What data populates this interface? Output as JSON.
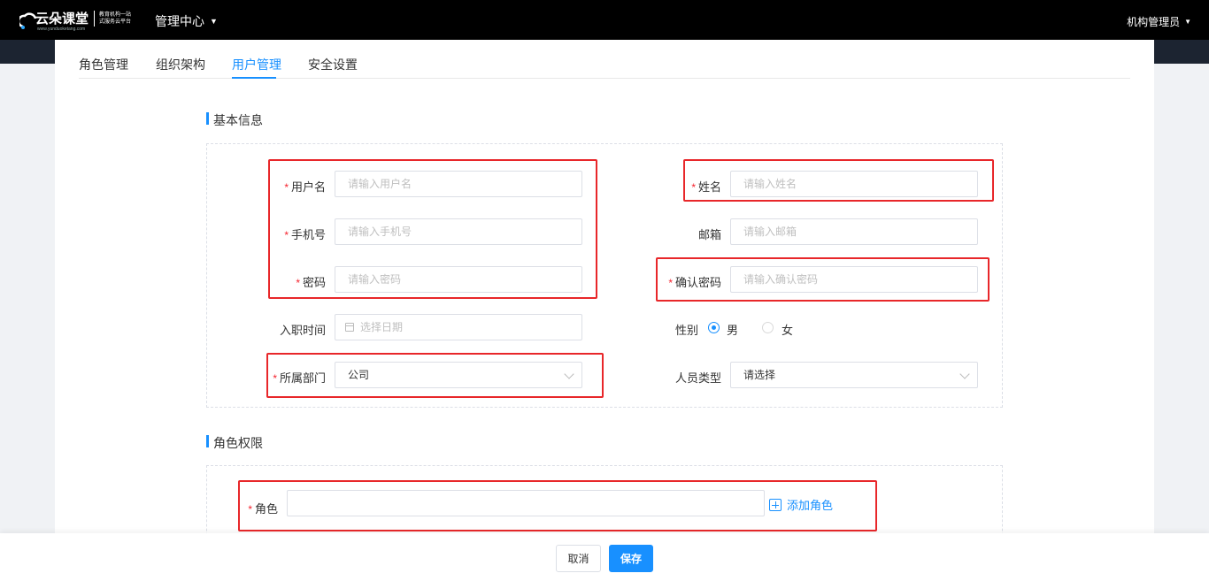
{
  "header": {
    "logo_name": "云朵课堂",
    "logo_url": "www.yunduoketang.com",
    "logo_slogan_1": "教育机构一站",
    "logo_slogan_2": "式服务云平台",
    "nav_center": "管理中心",
    "user": "机构管理员"
  },
  "tabs": [
    {
      "label": "角色管理"
    },
    {
      "label": "组织架构"
    },
    {
      "label": "用户管理",
      "active": true
    },
    {
      "label": "安全设置"
    }
  ],
  "sections": {
    "basic": "基本信息",
    "role": "角色权限"
  },
  "form": {
    "username": {
      "label": "用户名",
      "placeholder": "请输入用户名"
    },
    "name": {
      "label": "姓名",
      "placeholder": "请输入姓名"
    },
    "phone": {
      "label": "手机号",
      "placeholder": "请输入手机号"
    },
    "email": {
      "label": "邮箱",
      "placeholder": "请输入邮箱"
    },
    "password": {
      "label": "密码",
      "placeholder": "请输入密码"
    },
    "confirm_password": {
      "label": "确认密码",
      "placeholder": "请输入确认密码"
    },
    "hire_date": {
      "label": "入职时间",
      "placeholder": "选择日期"
    },
    "gender": {
      "label": "性别",
      "options": [
        "男",
        "女"
      ],
      "selected": "男"
    },
    "department": {
      "label": "所属部门",
      "value": "公司"
    },
    "staff_type": {
      "label": "人员类型",
      "value": "请选择"
    },
    "role": {
      "label": "角色",
      "value": ""
    },
    "add_role": "添加角色",
    "required_mark": "*"
  },
  "footer": {
    "cancel": "取消",
    "save": "保存"
  },
  "colors": {
    "accent": "#1890ff",
    "highlight": "#e8272a",
    "topbar": "#000000"
  }
}
